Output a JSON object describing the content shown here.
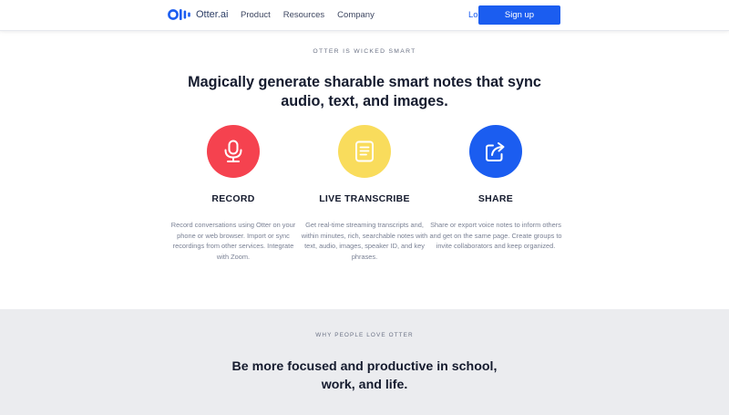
{
  "header": {
    "brand": "Otter.ai",
    "nav": [
      "Product",
      "Resources",
      "Company"
    ],
    "login_label": "Log in",
    "signup_label": "Sign up",
    "accent": "#1b5df0"
  },
  "hero": {
    "eyebrow": "OTTER IS WICKED SMART",
    "headline": "Magically generate sharable smart notes that sync audio, text, and images."
  },
  "features": [
    {
      "icon": "microphone-icon",
      "color": "#f5424f",
      "title": "RECORD",
      "description": "Record conversations using Otter on your phone or web browser. Import or sync recordings from other services. Integrate with Zoom."
    },
    {
      "icon": "document-icon",
      "color": "#f9dc5c",
      "title": "LIVE TRANSCRIBE",
      "description": "Get real-time streaming transcripts and, within minutes, rich, searchable notes with text, audio, images, speaker ID, and key phrases."
    },
    {
      "icon": "share-icon",
      "color": "#1b5df0",
      "title": "SHARE",
      "description": "Share or export voice notes to inform others and get on the same page. Create groups to invite collaborators and keep organized."
    }
  ],
  "love": {
    "eyebrow": "WHY PEOPLE LOVE OTTER",
    "headline": "Be more focused and productive in school, work, and life."
  }
}
